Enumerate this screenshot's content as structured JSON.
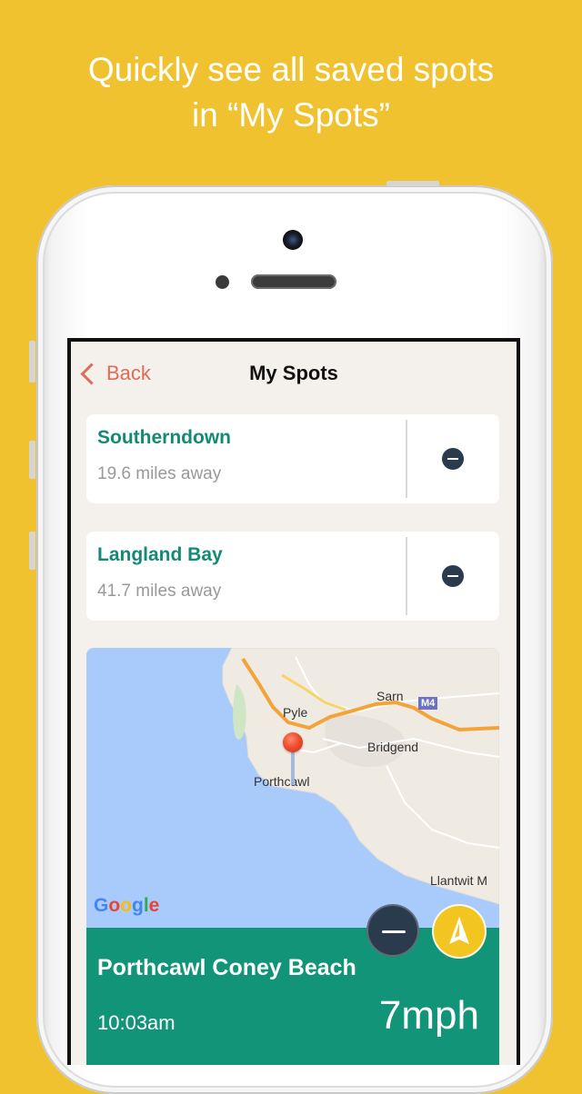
{
  "headline": {
    "line1": "Quickly see all saved spots",
    "line2": "in “My Spots”"
  },
  "colors": {
    "background": "#F0C22F",
    "accent_teal": "#129478",
    "back_red": "#E06B58",
    "button_navy": "#2B3B4E",
    "nav_yellow": "#F3C521"
  },
  "navbar": {
    "back_label": "Back",
    "back_icon": "chevron-left-icon",
    "title": "My Spots"
  },
  "spots": [
    {
      "name": "Southerndown",
      "distance": "19.6 miles away",
      "remove_icon": "minus-circle-icon"
    },
    {
      "name": "Langland Bay",
      "distance": "41.7 miles away",
      "remove_icon": "minus-circle-icon"
    }
  ],
  "map": {
    "labels": {
      "pyle": "Pyle",
      "sarn": "Sarn",
      "m4": "M4",
      "bridgend": "Bridgend",
      "porthcawl": "Porthcawl",
      "llantwit": "Llantwit M"
    },
    "google_letters": [
      "G",
      "o",
      "o",
      "g",
      "l",
      "e"
    ],
    "pin_icon": "map-pin-icon"
  },
  "current_spot": {
    "name": "Porthcawl Coney Beach",
    "time": "10:03am",
    "wind_speed": "7mph",
    "remove_icon": "minus-icon",
    "navigate_icon": "navigation-arrow-icon"
  }
}
